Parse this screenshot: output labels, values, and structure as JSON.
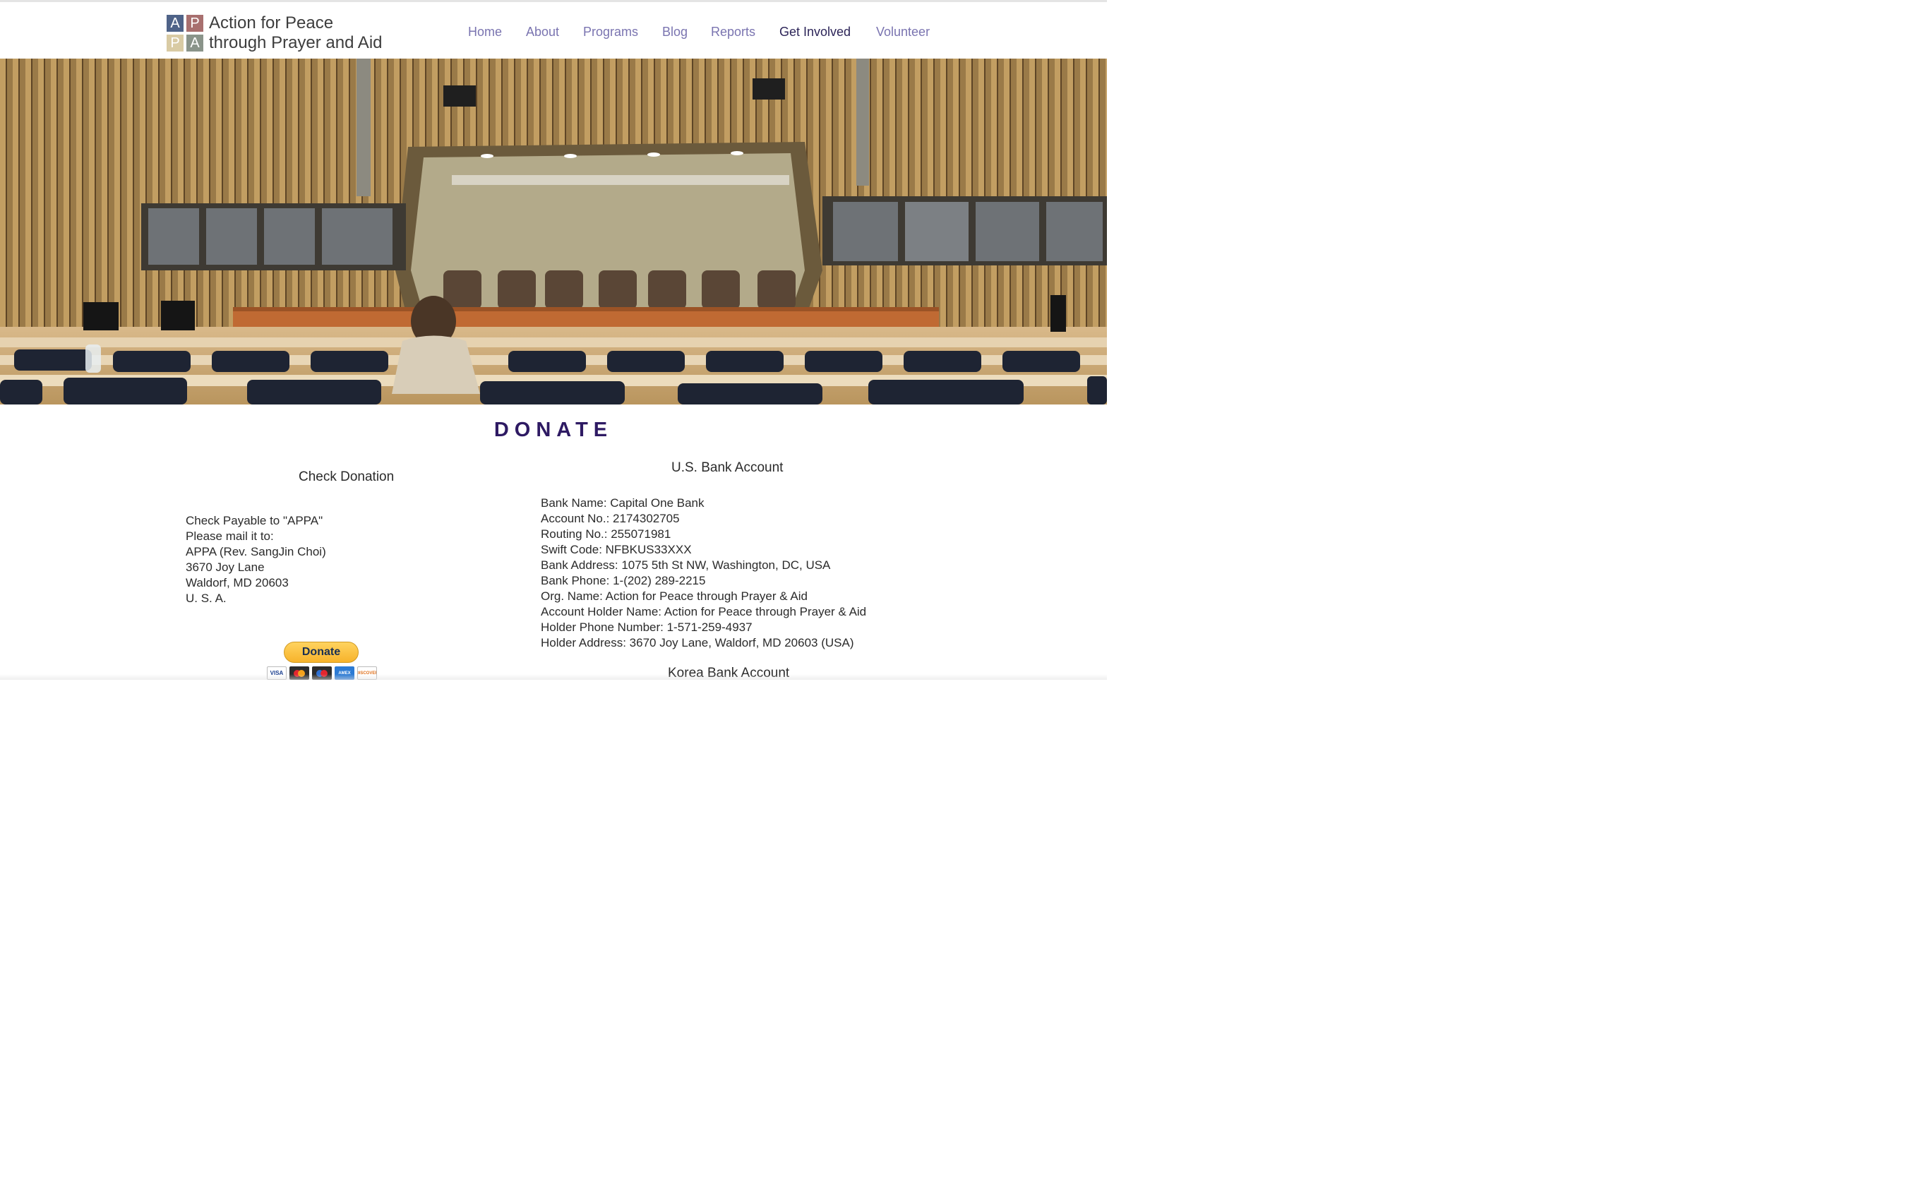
{
  "brand": {
    "logo_letters": [
      "A",
      "P",
      "P",
      "A"
    ],
    "name_line1": "Action for Peace",
    "name_line2": "through Prayer and Aid"
  },
  "nav": {
    "items": [
      {
        "label": "Home"
      },
      {
        "label": "About"
      },
      {
        "label": "Programs"
      },
      {
        "label": "Blog"
      },
      {
        "label": "Reports"
      },
      {
        "label": "Get Involved"
      },
      {
        "label": "Volunteer"
      }
    ],
    "active": "Get Involved"
  },
  "hero": {
    "description_icon": "conference-hall-image"
  },
  "donate": {
    "title": "DONATE",
    "check": {
      "heading": "Check Donation",
      "lines": [
        "Check Payable to \"APPA\"",
        "Please mail it to:",
        "APPA (Rev. SangJin Choi)",
        "3670 Joy Lane",
        "Waldorf, MD 20603",
        "U. S. A."
      ],
      "paypal_label": "Donate",
      "cards": [
        "VISA",
        "",
        "",
        "AMEX",
        "DISCOVER"
      ]
    },
    "us_bank": {
      "heading": "U.S. Bank Account",
      "lines": [
        "Bank Name: Capital One Bank",
        "Account No.: 2174302705",
        "Routing No.: 255071981",
        "Swift Code: NFBKUS33XXX",
        "Bank Address: 1075 5th St NW, Washington, DC, USA",
        "Bank Phone: 1-(202) 289-2215",
        "Org. Name: Action for Peace through Prayer & Aid",
        "Account Holder Name: Action for Peace through Prayer & Aid",
        "Holder Phone Number: 1-571-259-4937",
        "Holder Address: 3670 Joy Lane, Waldorf, MD 20603 (USA)"
      ]
    },
    "korea_bank": {
      "heading": "Korea Bank Account"
    }
  },
  "colors": {
    "nav": "#7a74b0",
    "nav_active": "#2c2458",
    "donate_title": "#2e1a63"
  }
}
